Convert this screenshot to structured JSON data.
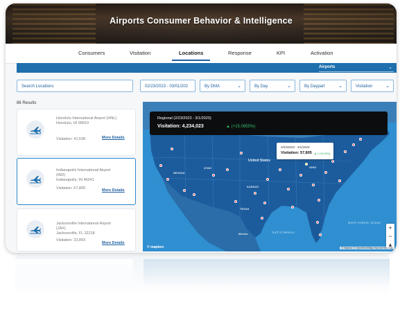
{
  "header": {
    "title": "Airports Consumer Behavior & Intelligence"
  },
  "nav": {
    "tabs": [
      {
        "label": "Consumers"
      },
      {
        "label": "Visitation"
      },
      {
        "label": "Locations",
        "active": true
      },
      {
        "label": "Response"
      },
      {
        "label": "KPI"
      },
      {
        "label": "Activation"
      }
    ]
  },
  "category_select": {
    "value": "Airports"
  },
  "filters": {
    "search_placeholder": "Search Locations",
    "date_range": "02/23/2023 - 03/01/202",
    "region": "By DMA",
    "interval": "By Day",
    "daypart": "By Daypart",
    "metric": "Visitation"
  },
  "results": {
    "count_label": "86 Results"
  },
  "locations": [
    {
      "name_line1": "Honolulu International Airport (HNL)",
      "name_line2": "Honolulu, HI 96819",
      "visitation": "Visitation: 41,538",
      "more": "More Details"
    },
    {
      "name_line1": "Indianapolis International Airport",
      "name_line2": "(IND)",
      "name_line3": "Indianapolis, IN 46241",
      "visitation": "Visitation: 57,805",
      "more": "More Details",
      "selected": true
    },
    {
      "name_line1": "Jacksonville International Airport",
      "name_line2": "(JAX)",
      "name_line3": "Jacksonville, FL 32218",
      "visitation": "Visitation: 22,893",
      "more": "More Details"
    }
  ],
  "map": {
    "regional_tooltip": {
      "period": "Regional (2/23/2023 - 3/1/2023)",
      "visitation": "Visitation: 4,234,023",
      "change": "▲ (+15.0955%)"
    },
    "point_tooltip": {
      "period": "2/23/2023 - 3/1/2023",
      "visitation": "Visitation: 57,805",
      "change": "▲ (+15.09%)"
    },
    "labels": {
      "country": "United States",
      "mexico": "Mexico",
      "gulf": "Gulf of Mexico",
      "atlantic": "North Atlantic Ocean",
      "utah": "UTAH",
      "nevada": "NEVADA",
      "ohio": "OHIO",
      "texas": "TEXAS",
      "kansas": "KANSAS"
    },
    "zoom_in": "+",
    "zoom_out": "−",
    "compass": "▴",
    "logo": "© mapbox",
    "attribution": "© Mapbox © OpenStreetMap  Improve this map",
    "accent": "#2f8fd0",
    "marker_color": "#ff3b3b"
  },
  "colors": {
    "brand_blue": "#1e6fae",
    "link_blue": "#1b5fa0",
    "positive": "#32c36b"
  }
}
